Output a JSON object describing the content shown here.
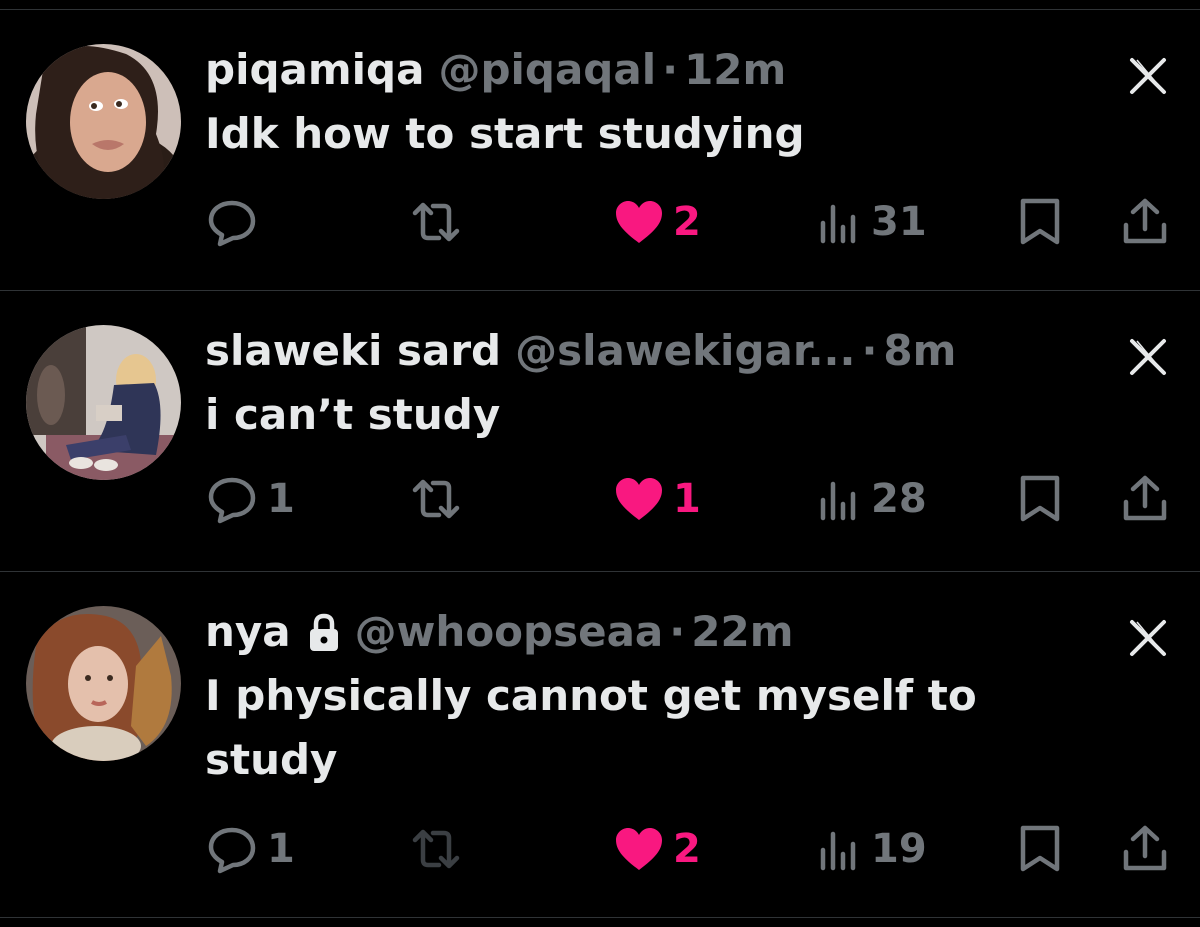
{
  "colors": {
    "background": "#000000",
    "text_primary": "#e7e9ea",
    "text_secondary": "#71767b",
    "like_active": "#f91880",
    "divider": "#2f3336"
  },
  "posts": [
    {
      "display_name": "piqamiqa",
      "handle": "@piqaqal",
      "separator": "·",
      "time": "12m",
      "protected": false,
      "text": "Idk how to start studying",
      "replies": "",
      "likes": "2",
      "views": "31",
      "icons": {
        "reply": "reply-icon",
        "repost": "repost-icon",
        "like": "heart-filled-icon",
        "views": "views-icon",
        "bookmark": "bookmark-icon",
        "share": "share-icon",
        "close": "x-close-icon"
      }
    },
    {
      "display_name": "slaweki sard",
      "handle": "@slawekigar...",
      "separator": "·",
      "time": "8m",
      "protected": false,
      "text": "i can’t study",
      "replies": "1",
      "likes": "1",
      "views": "28",
      "icons": {
        "reply": "reply-icon",
        "repost": "repost-icon",
        "like": "heart-filled-icon",
        "views": "views-icon",
        "bookmark": "bookmark-icon",
        "share": "share-icon",
        "close": "x-close-icon"
      }
    },
    {
      "display_name": "nya",
      "handle": "@whoopseaa",
      "separator": "·",
      "time": "22m",
      "protected": true,
      "text": "I physically cannot get myself to study",
      "replies": "1",
      "likes": "2",
      "views": "19",
      "icons": {
        "reply": "reply-icon",
        "repost": "repost-icon-disabled",
        "like": "heart-filled-icon",
        "views": "views-icon",
        "bookmark": "bookmark-icon",
        "share": "share-icon",
        "close": "x-close-icon",
        "protected": "lock-icon"
      }
    }
  ]
}
